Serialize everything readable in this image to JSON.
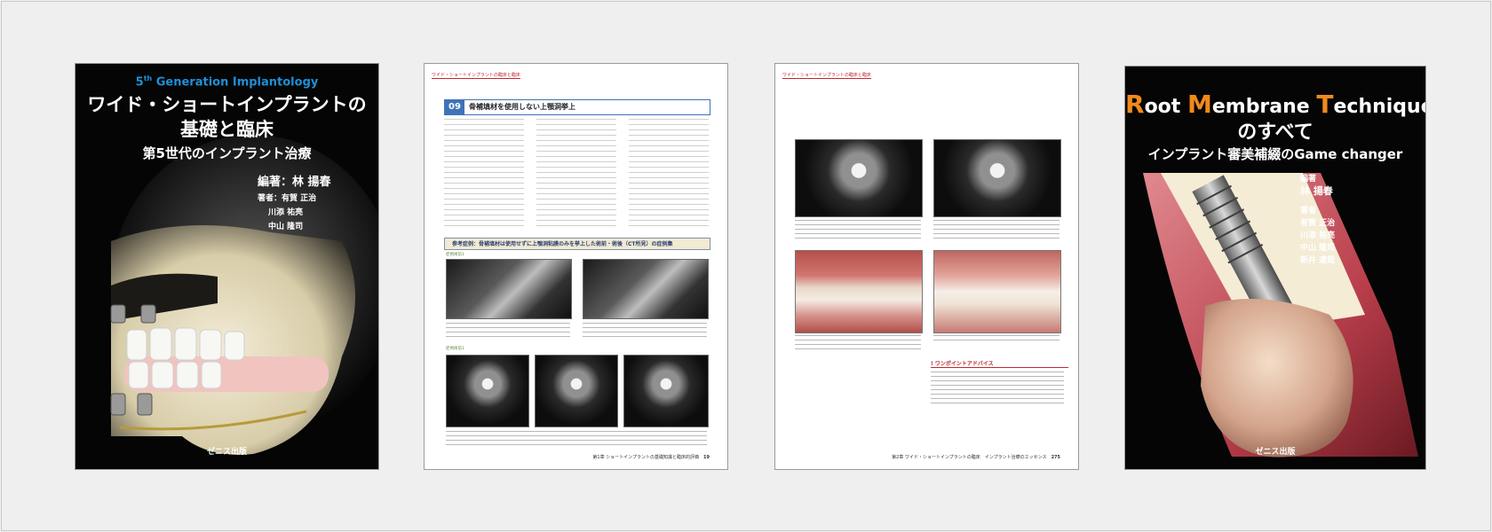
{
  "books": [
    {
      "series_prefix": "5",
      "series_sup": "th",
      "series_rest": " Generation Implantology",
      "title_line1": "ワイド・ショートインプラントの",
      "title_line2": "基礎と臨床",
      "subtitle": "第5世代のインプラント治療",
      "author_main": "編著：林 揚春",
      "author_line1": "著者：有賀 正治",
      "author_line2": "川添 祐亮",
      "author_line3": "中山 隆司",
      "publisher": "ゼニス出版"
    },
    {
      "header": "ワイド・ショートインプラントの臨床と臨床",
      "section_num": "09",
      "section_title": "骨補填材を使用しない上顎洞挙上",
      "case_title": "参考症例：骨補填材は使用せずに上顎洞粘膜のみを挙上した術前・術後（CT所見）の症例集",
      "label_pre": "症例術前1",
      "label_post": "症例術前1",
      "footer": "第1章 ショートインプラントの基礎知識と臨床的評価",
      "page_num": "19"
    },
    {
      "header": "ワイド・ショートインプラントの臨床と臨床",
      "advice_title": "ワンポイントアドバイス",
      "footer": "第2章 ワイド・ショートインプラントの臨床　インプラント治療のエッセンス",
      "page_num": "275"
    },
    {
      "title_r": "R",
      "title_oot": "oot ",
      "title_m": "M",
      "title_embrane": "embrane ",
      "title_t": "T",
      "title_echnique": "echnique",
      "title_line2": "のすべて",
      "subtitle": "インプラント審美補綴のGame changer",
      "editor_label": "編著",
      "editor_name": "林 揚春",
      "authors_label": "著者",
      "author1": "有賀 正治",
      "author2": "川添 祐亮",
      "author3": "中山 隆司",
      "author4": "新井 達哉",
      "publisher": "ゼニス出版",
      "accent_color": "#f08a1c"
    }
  ]
}
